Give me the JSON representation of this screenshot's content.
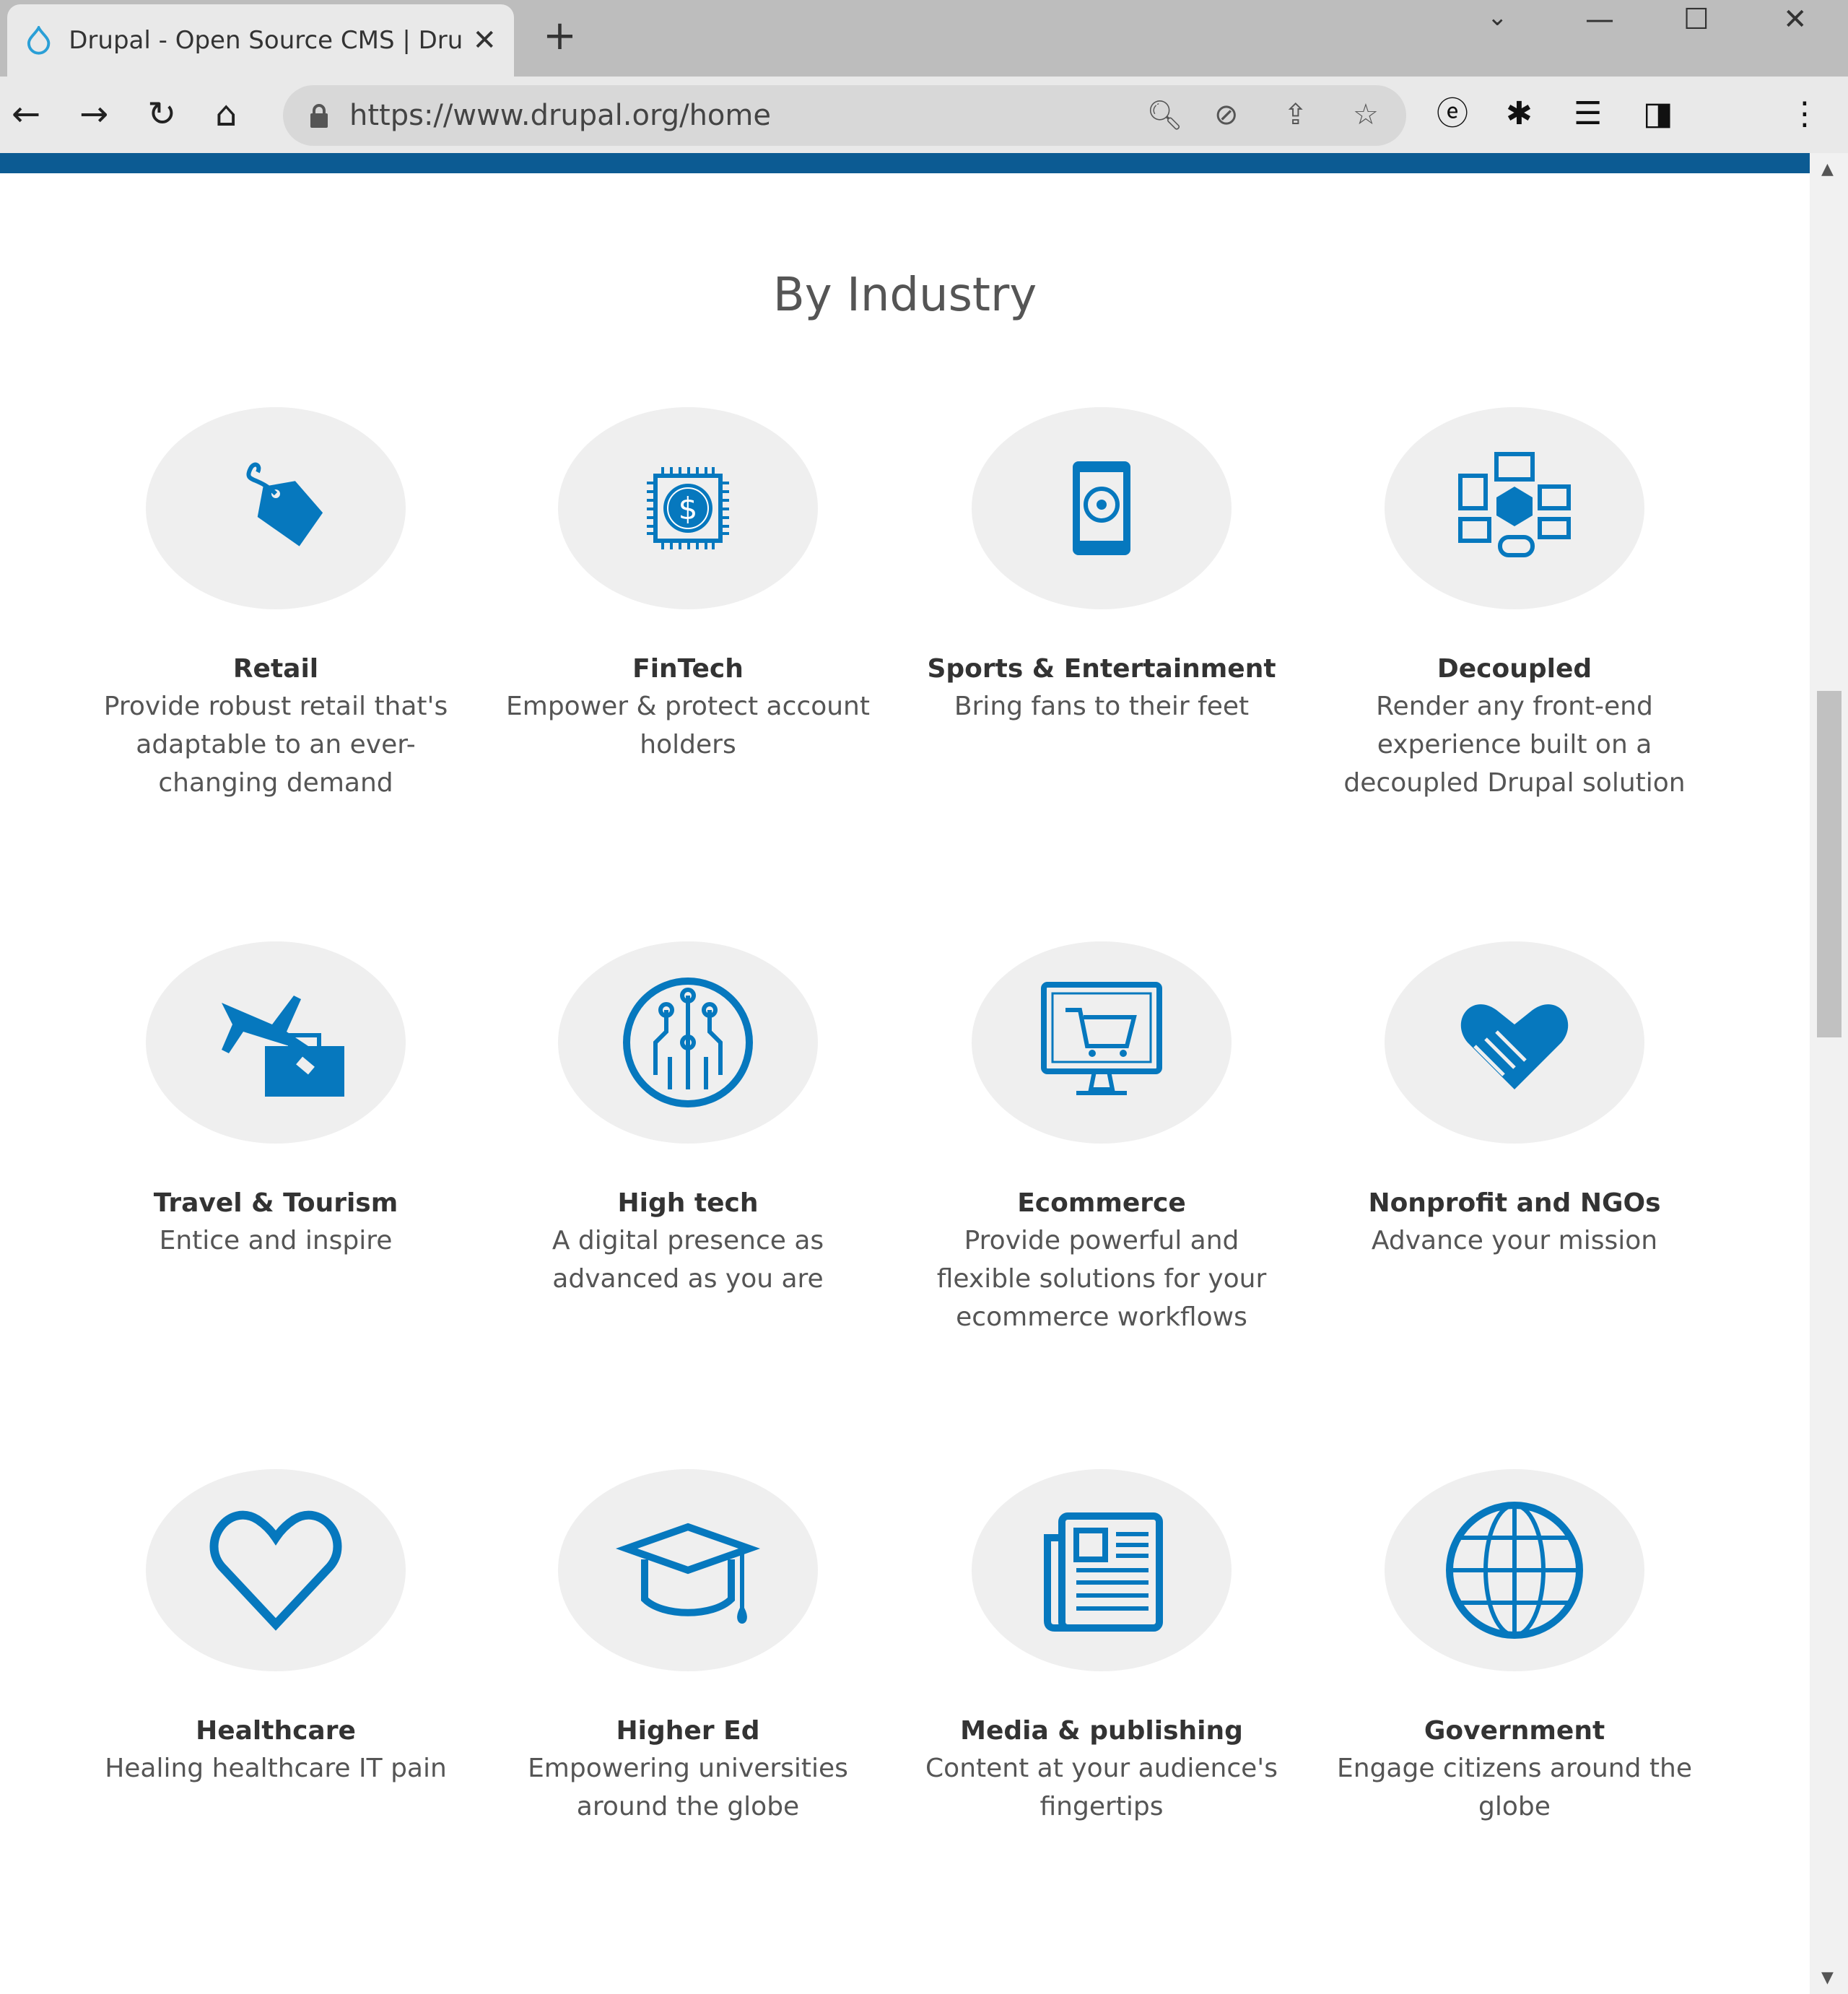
{
  "browser": {
    "tab_title": "Drupal - Open Source CMS | Drupal.org",
    "url": "https://www.drupal.org/home",
    "icons": [
      "back-icon",
      "forward-icon",
      "reload-icon",
      "home-icon",
      "lock-icon",
      "zoom-icon",
      "eye-off-icon",
      "share-icon",
      "star-icon",
      "extension-e-icon",
      "puzzle-icon",
      "media-queue-icon",
      "sidebar-icon",
      "menu-icon"
    ]
  },
  "page": {
    "heading": "By Industry",
    "accent": "#0678be",
    "industries": [
      {
        "icon": "price-tag-icon",
        "title": "Retail",
        "desc": "Provide robust retail that's adaptable to an ever-changing demand"
      },
      {
        "icon": "chip-dollar-icon",
        "title": "FinTech",
        "desc": "Empower & protect account holders"
      },
      {
        "icon": "phone-soccer-icon",
        "title": "Sports & Entertainment",
        "desc": "Bring fans to their feet"
      },
      {
        "icon": "devices-icon",
        "title": "Decoupled",
        "desc": "Render any front-end experience built on a decoupled Drupal solution"
      },
      {
        "icon": "plane-luggage-icon",
        "title": "Travel & Tourism",
        "desc": "Entice and inspire"
      },
      {
        "icon": "circuit-icon",
        "title": "High tech",
        "desc": "A digital presence as advanced as you are"
      },
      {
        "icon": "monitor-cart-icon",
        "title": "Ecommerce",
        "desc": "Provide powerful and flexible solutions for your ecommerce workflows"
      },
      {
        "icon": "heart-hand-icon",
        "title": "Nonprofit and NGOs",
        "desc": "Advance your mission"
      },
      {
        "icon": "heart-icon",
        "title": "Healthcare",
        "desc": "Healing healthcare IT pain"
      },
      {
        "icon": "graduation-cap-icon",
        "title": "Higher Ed",
        "desc": "Empowering universities around the globe"
      },
      {
        "icon": "newspaper-icon",
        "title": "Media & publishing",
        "desc": "Content at your audience's fingertips"
      },
      {
        "icon": "globe-icon",
        "title": "Government",
        "desc": "Engage citizens around the globe"
      }
    ]
  }
}
